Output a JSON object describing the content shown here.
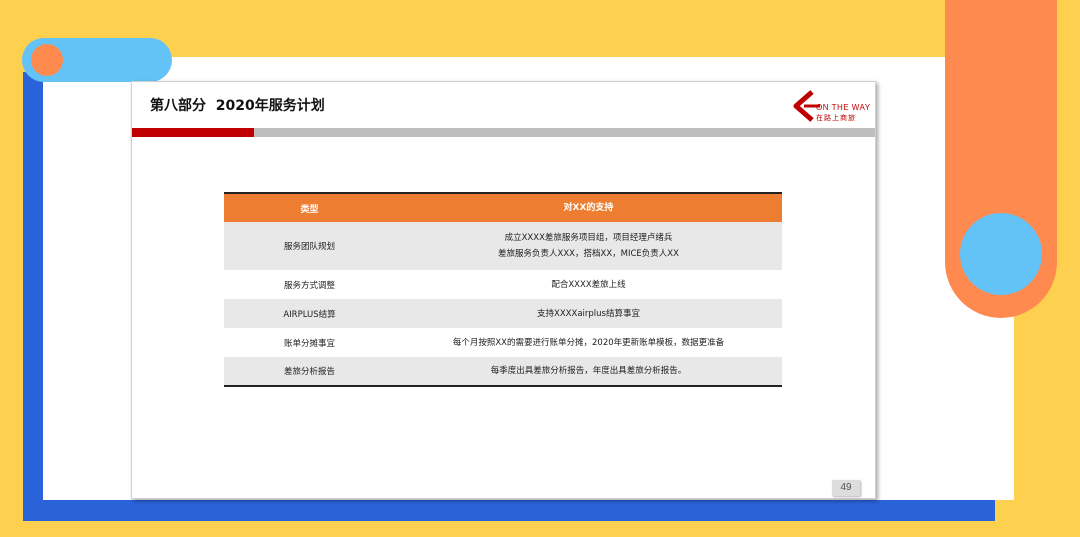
{
  "slide": {
    "title": "第八部分  2020年服务计划",
    "logo_en": "ON THE WAY",
    "logo_cn": "在路上商旅",
    "page_number": "49"
  },
  "table": {
    "headers": [
      "类型",
      "对XX的支持"
    ],
    "rows": [
      {
        "type": "服务团队规划",
        "support": [
          "成立XXXX差旅服务项目组，项目经理卢绪兵",
          "差旅服务负责人XXX，搭档XX，MICE负责人XX"
        ]
      },
      {
        "type": "服务方式调整",
        "support": [
          "配合XXXX差旅上线"
        ]
      },
      {
        "type": "AIRPLUS结算",
        "support": [
          "支持XXXXairplus结算事宜"
        ]
      },
      {
        "type": "账单分摊事宜",
        "support": [
          "每个月按照XX的需要进行账单分摊，2020年更新账单模板，数据更准备"
        ]
      },
      {
        "type": "差旅分析报告",
        "support": [
          "每季度出具差旅分析报告，年度出具差旅分析报告。"
        ]
      }
    ]
  },
  "colors": {
    "background": "#fdd04f",
    "frame_blue": "#2a63d9",
    "accent_orange": "#ff8a50",
    "light_blue": "#63c3f7",
    "header_orange": "#ed7d31",
    "brand_red": "#c00000"
  }
}
